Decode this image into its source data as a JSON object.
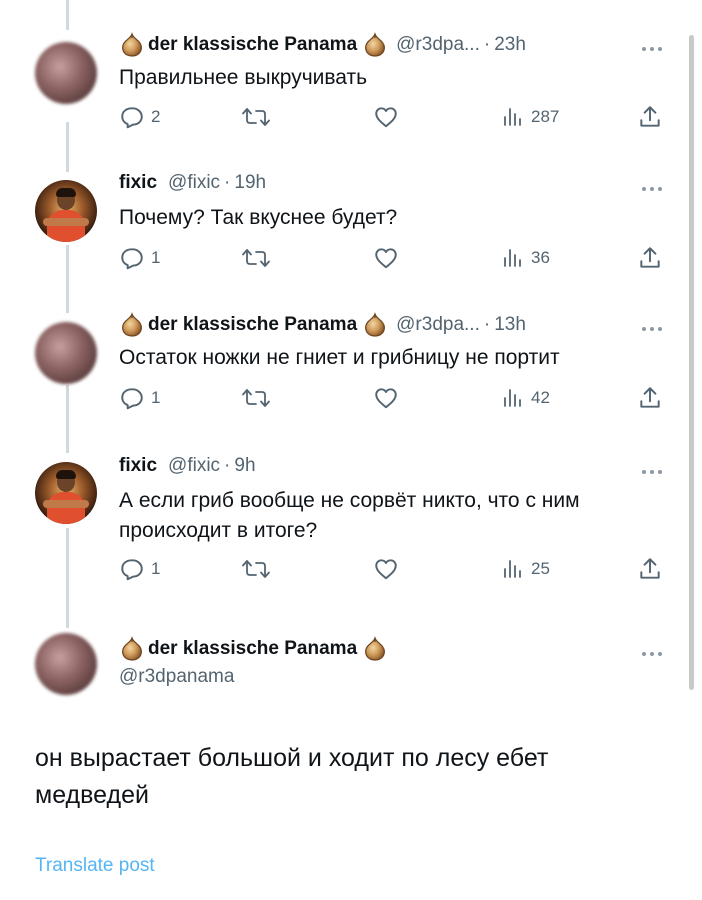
{
  "tweets": [
    {
      "author": "der klassische Panama",
      "handle": "@r3dpa...",
      "sep": "·",
      "time": "23h",
      "text": "Правильнее выкручивать",
      "replies": "2",
      "views": "287",
      "name_emoji_icons": [
        "onion-icon",
        "onion-icon"
      ]
    },
    {
      "author": "fixic",
      "handle": "@fixic",
      "sep": "·",
      "time": "19h",
      "text": "Почему? Так вкуснее будет?",
      "replies": "1",
      "views": "36"
    },
    {
      "author": "der klassische Panama",
      "handle": "@r3dpa...",
      "sep": "·",
      "time": "13h",
      "text": "Остаток ножки не гниет и грибницу не портит",
      "replies": "1",
      "views": "42"
    },
    {
      "author": "fixic",
      "handle": "@fixic",
      "sep": "·",
      "time": "9h",
      "text": "А если гриб вообще не сорвёт никто, что с ним происходит в итоге?",
      "replies": "1",
      "views": "25"
    }
  ],
  "main_post": {
    "author": "der klassische Panama",
    "handle": "@r3dpanama",
    "text": "он вырастает большой и ходит по лесу ебет медведей",
    "translate_label": "Translate post"
  },
  "icons": {
    "reply": "reply-icon",
    "repost": "repost-icon",
    "like": "like-icon",
    "views": "views-icon",
    "share": "share-icon",
    "more": "more-icon",
    "name_emoji": "onion-icon"
  },
  "colors": {
    "text_primary": "#0f1419",
    "text_secondary": "#536471",
    "link": "#1d9bf0",
    "thread_line": "#cfd9de"
  }
}
